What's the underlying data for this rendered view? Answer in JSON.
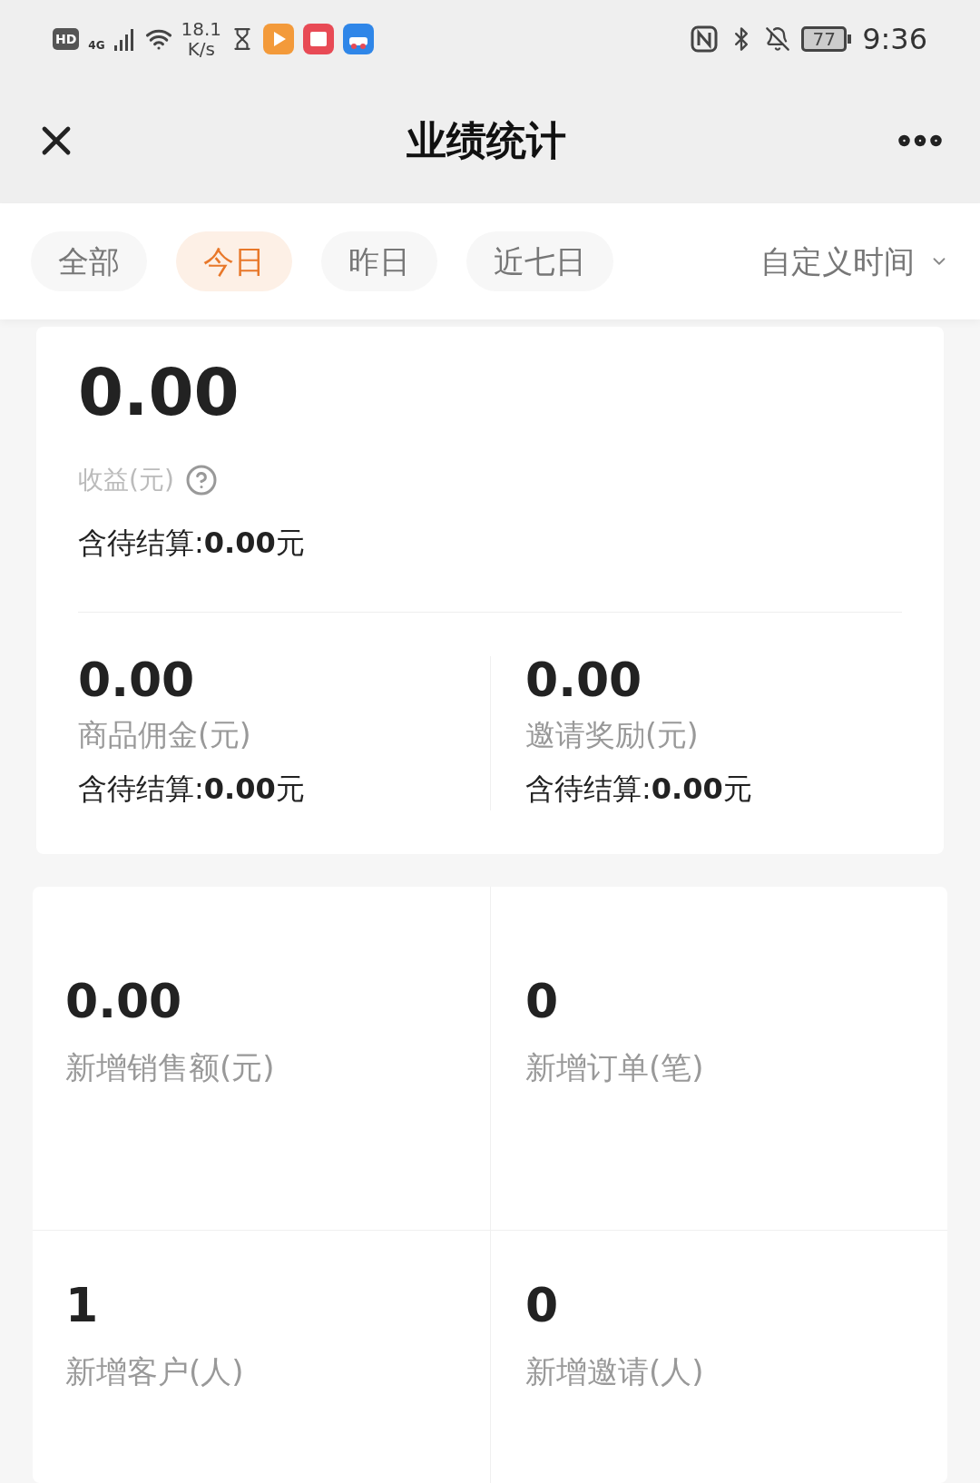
{
  "status_bar": {
    "hd": "HD",
    "network": "4G",
    "speed": "18.1",
    "speed_unit": "K/s",
    "battery": "77",
    "time": "9:36"
  },
  "header": {
    "title": "业绩统计"
  },
  "tabs": [
    {
      "label": "全部",
      "selected": false
    },
    {
      "label": "今日",
      "selected": true
    },
    {
      "label": "昨日",
      "selected": false
    },
    {
      "label": "近七日",
      "selected": false
    }
  ],
  "custom_time": {
    "label": "自定义时间"
  },
  "earnings": {
    "value": "0.00",
    "label": "收益(元)",
    "pending_label": "含待结算:",
    "pending_value": "0.00",
    "pending_unit": "元"
  },
  "breakdown": [
    {
      "value": "0.00",
      "label": "商品佣金(元)",
      "pending_label": "含待结算:",
      "pending_value": "0.00",
      "pending_unit": "元"
    },
    {
      "value": "0.00",
      "label": "邀请奖励(元)",
      "pending_label": "含待结算:",
      "pending_value": "0.00",
      "pending_unit": "元"
    }
  ],
  "stats": [
    {
      "value": "0.00",
      "label": "新增销售额(元)"
    },
    {
      "value": "0",
      "label": "新增订单(笔)"
    },
    {
      "value": "1",
      "label": "新增客户(人)"
    },
    {
      "value": "0",
      "label": "新增邀请(人)"
    }
  ]
}
